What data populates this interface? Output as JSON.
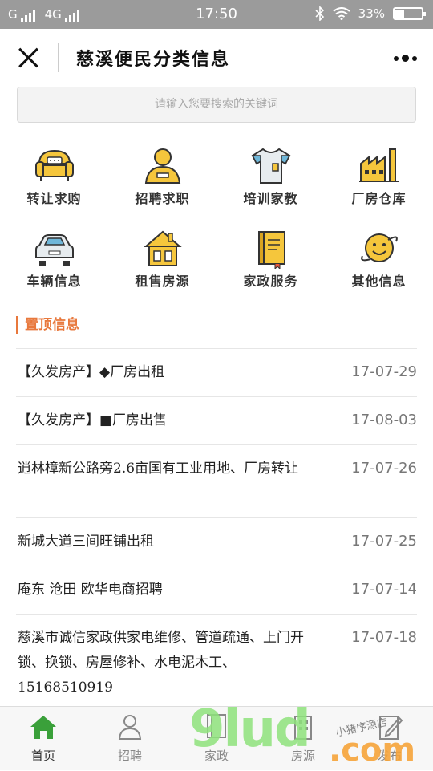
{
  "status_bar": {
    "carrier": "G",
    "network": "4G",
    "time": "17:50",
    "battery_percent": "33%",
    "battery_level": 0.33
  },
  "header": {
    "title": "慈溪便民分类信息"
  },
  "search": {
    "placeholder": "请输入您要搜索的关键词"
  },
  "categories": [
    {
      "label": "转让求购",
      "icon": "sofa-icon"
    },
    {
      "label": "招聘求职",
      "icon": "person-badge-icon"
    },
    {
      "label": "培训家教",
      "icon": "tshirt-icon"
    },
    {
      "label": "厂房仓库",
      "icon": "factory-icon"
    },
    {
      "label": "车辆信息",
      "icon": "car-icon"
    },
    {
      "label": "租售房源",
      "icon": "house-icon"
    },
    {
      "label": "家政服务",
      "icon": "book-icon"
    },
    {
      "label": "其他信息",
      "icon": "smiley-planet-icon"
    }
  ],
  "section": {
    "title": "置顶信息"
  },
  "listings": [
    {
      "text": "【久发房产】◆厂房出租",
      "date": "17-07-29"
    },
    {
      "text": "【久发房产】■厂房出售",
      "date": "17-08-03"
    },
    {
      "text": "逍林樟新公路旁2.6亩国有工业用地、厂房转让",
      "date": "17-07-26"
    },
    {
      "text": "新城大道三间旺铺出租",
      "date": "17-07-25"
    },
    {
      "text": "庵东 沧田 欧华电商招聘",
      "date": "17-07-14"
    },
    {
      "text": "慈溪市诚信家政供家电维修、管道疏通、上门开锁、换锁、房屋修补、水电泥木工、15168510919",
      "date": "17-07-18"
    }
  ],
  "tabs": [
    {
      "label": "首页",
      "icon": "home-icon",
      "active": true
    },
    {
      "label": "招聘",
      "icon": "user-icon",
      "active": false
    },
    {
      "label": "家政",
      "icon": "book-icon",
      "active": false
    },
    {
      "label": "房源",
      "icon": "building-icon",
      "active": false
    },
    {
      "label": "发布",
      "icon": "edit-icon",
      "active": false
    }
  ],
  "watermark": {
    "text": "9lud",
    "suffix": ".com",
    "tagline": "小猪序源店"
  },
  "colors": {
    "accent": "#e8783c",
    "icon_yellow": "#f5c63c",
    "tab_active": "#3aa03a"
  }
}
